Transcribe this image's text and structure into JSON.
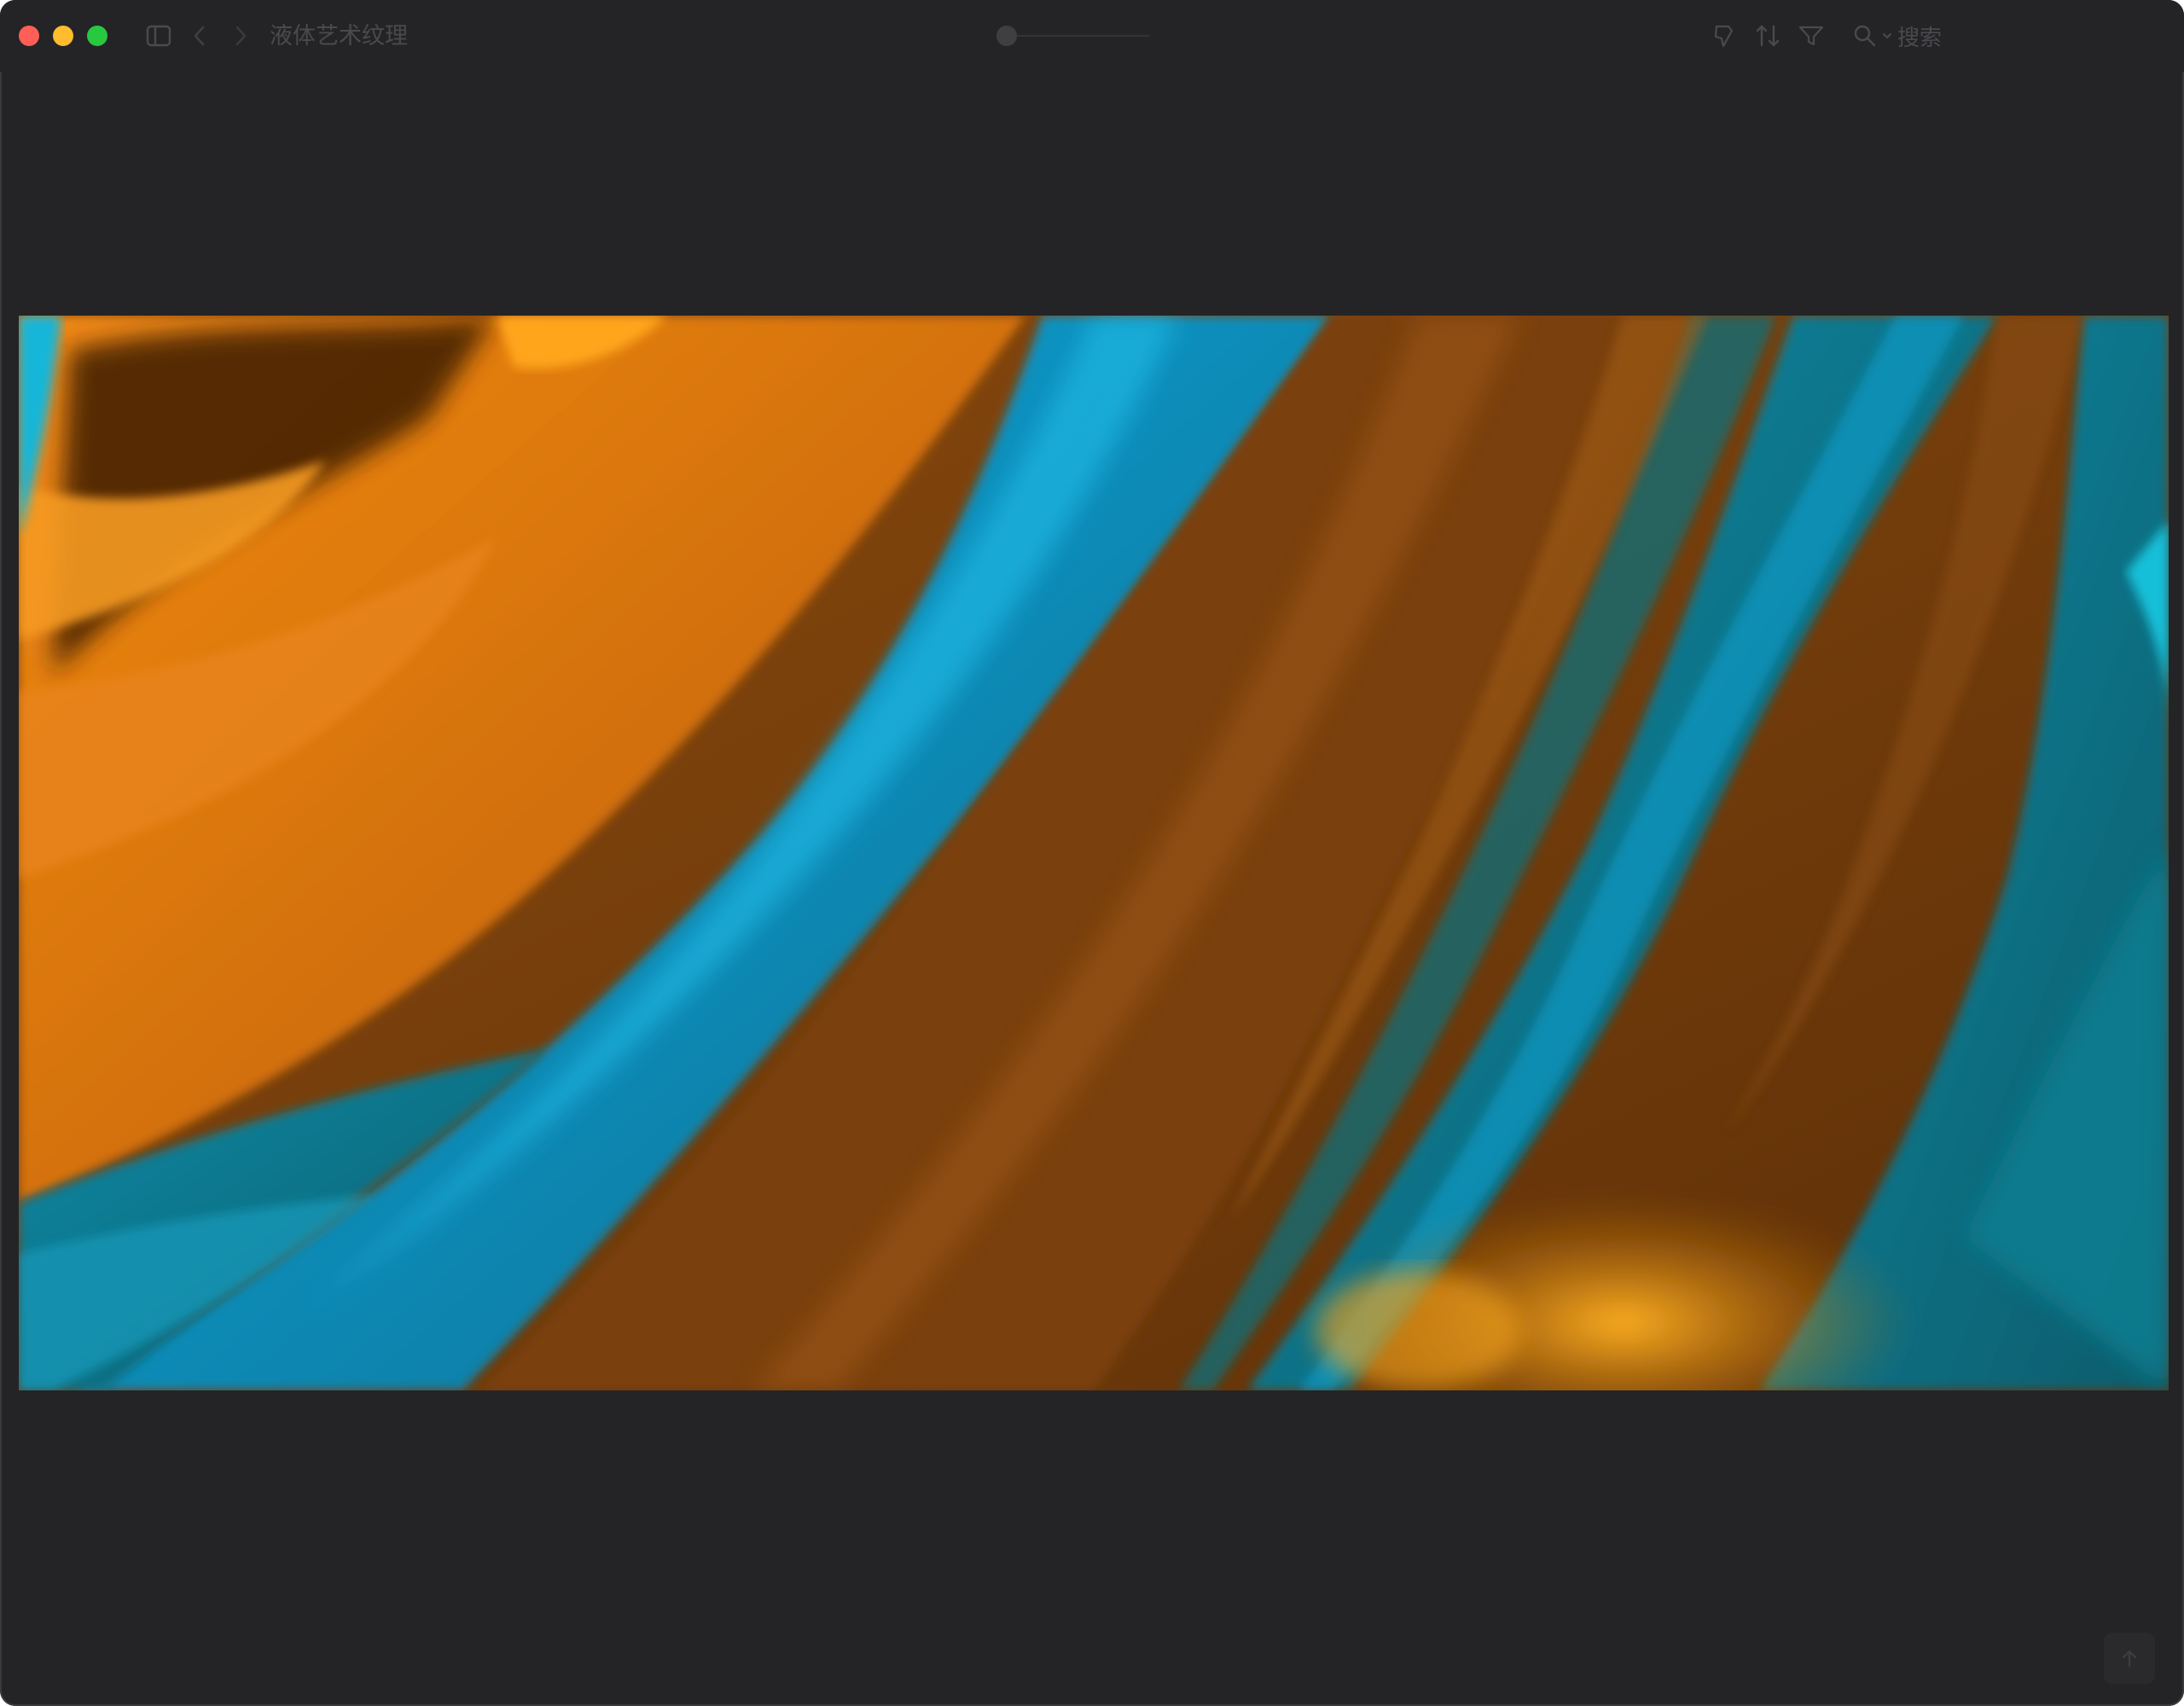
{
  "window": {
    "title": "液体艺术纹理"
  },
  "toolbar": {
    "search_label": "搜索",
    "icons": [
      "sidebar-icon",
      "chevron-left-icon",
      "chevron-right-icon",
      "tag-icon",
      "sort-icon",
      "filter-icon",
      "search-icon"
    ]
  },
  "image": {
    "description_colors": {
      "orange": "#e07a12",
      "blue": "#0a9ad0",
      "teal": "#0d6f80",
      "brown": "#6b3408"
    }
  },
  "colors": {
    "window_bg": "#242426",
    "close": "#ff5f57",
    "minimize": "#febc2e",
    "maximize": "#28c840"
  }
}
